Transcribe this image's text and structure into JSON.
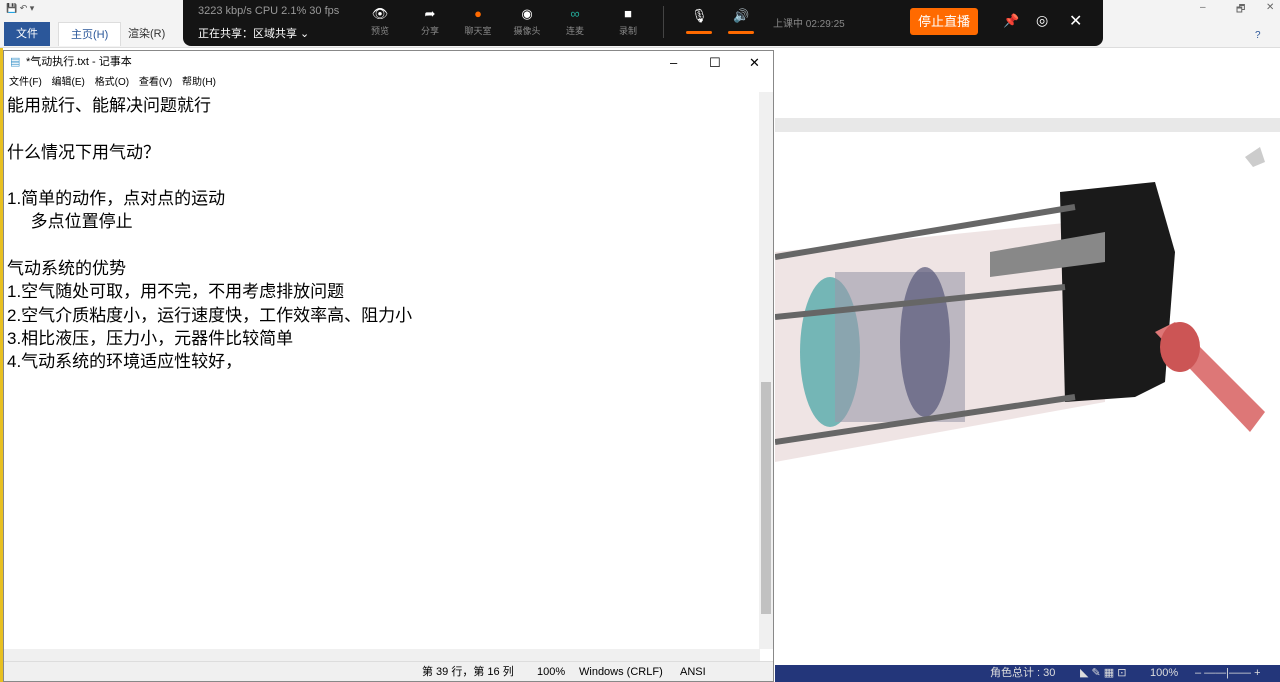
{
  "ribbon": {
    "tabs": [
      "文件",
      "主页(H)",
      "渲染(R)"
    ]
  },
  "live": {
    "stats": "3223 kbp/s   CPU 2.1%   30 fps",
    "sharing": "正在共享：区域共享",
    "tools": [
      "预览",
      "分享",
      "聊天室",
      "摄像头",
      "连麦",
      "录制"
    ],
    "timer": "上课中 02:29:25",
    "stop_label": "停止直播"
  },
  "notepad": {
    "title": "*气动执行.txt - 记事本",
    "menu": [
      "文件(F)",
      "编辑(E)",
      "格式(O)",
      "查看(V)",
      "帮助(H)"
    ],
    "lines": [
      "能用就行、能解决问题就行",
      "",
      "什么情况下用气动？",
      "",
      "1.简单的动作，点对点的运动",
      "     多点位置停止",
      "",
      "气动系统的优势",
      "1.空气随处可取，用不完，不用考虑排放问题",
      "2.空气介质粘度小，运行速度快，工作效率高、阻力小",
      "3.相比液压，压力小，元器件比较简单",
      "4.气动系统的环境适应性较好，"
    ],
    "status": {
      "position": "第 39 行，第 16 列",
      "zoom": "100%",
      "eol": "Windows (CRLF)",
      "encoding": "ANSI"
    }
  },
  "cad": {
    "status": {
      "count": "角色总计 : 30",
      "zoom": "100%"
    }
  }
}
